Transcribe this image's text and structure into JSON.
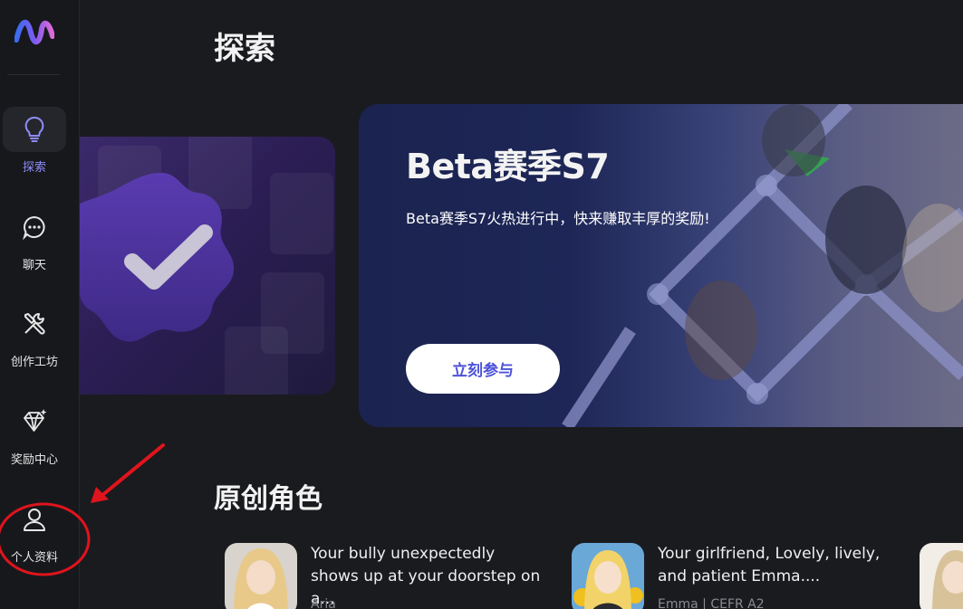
{
  "sidebar": {
    "items": [
      {
        "label": "探索",
        "icon": "lightbulb-icon",
        "active": true
      },
      {
        "label": "聊天",
        "icon": "chat-bubble-icon"
      },
      {
        "label": "创作工坊",
        "icon": "tools-icon"
      },
      {
        "label": "奖励中心",
        "icon": "diamond-icon"
      },
      {
        "label": "个人资料",
        "icon": "user-icon"
      }
    ]
  },
  "page": {
    "title": "探索"
  },
  "banner": {
    "title": "Beta赛季S7",
    "subtitle": "Beta赛季S7火热进行中，快来赚取丰厚的奖励!",
    "cta": "立刻参与"
  },
  "section": {
    "title": "原创角色"
  },
  "characters": [
    {
      "desc": "Your bully unexpectedly shows up at your doorstep on a...",
      "meta": "Aria"
    },
    {
      "desc": "Your girlfriend, Lovely, lively, and patient Emma....",
      "meta": "Emma | CEFR A2"
    }
  ],
  "colors": {
    "accent": "#8d8cf6",
    "cta_text": "#4c52d8",
    "annotation": "#e0141c"
  }
}
